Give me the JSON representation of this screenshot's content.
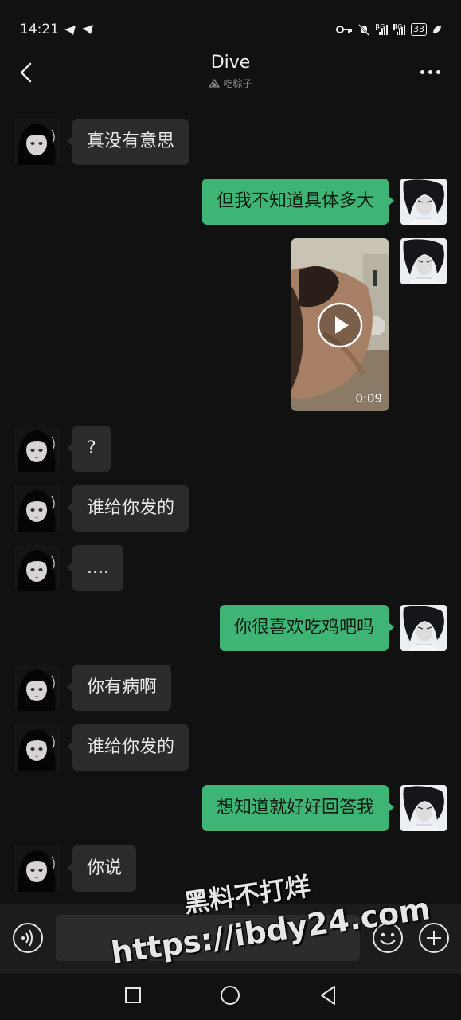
{
  "status": {
    "time": "14:21",
    "net1": "4G",
    "net2": "4G",
    "battery": "33"
  },
  "header": {
    "title": "Dive",
    "subtitle": "吃粽子",
    "back_icon": "chevron-left-icon",
    "more_icon": "more-icon"
  },
  "messages": [
    {
      "side": "in",
      "type": "text",
      "text": "真没有意思"
    },
    {
      "side": "out",
      "type": "text",
      "text": "但我不知道具体多大"
    },
    {
      "side": "out",
      "type": "video",
      "duration": "0:09"
    },
    {
      "side": "in",
      "type": "text",
      "text": "?"
    },
    {
      "side": "in",
      "type": "text",
      "text": "谁给你发的"
    },
    {
      "side": "in",
      "type": "text",
      "text": "...."
    },
    {
      "side": "out",
      "type": "text",
      "text": "你很喜欢吃鸡吧吗"
    },
    {
      "side": "in",
      "type": "text",
      "text": "你有病啊"
    },
    {
      "side": "in",
      "type": "text",
      "text": "谁给你发的"
    },
    {
      "side": "out",
      "type": "text",
      "text": "想知道就好好回答我"
    },
    {
      "side": "in",
      "type": "text",
      "text": "你说"
    }
  ],
  "input": {
    "value": "",
    "voice_icon": "voice-icon",
    "emoji_icon": "emoji-icon",
    "plus_icon": "plus-icon"
  },
  "watermark": {
    "line1": "黑料不打烊",
    "line2": "https://ibdy24.com"
  },
  "colors": {
    "background": "#111111",
    "incoming_bubble": "#2b2b2b",
    "outgoing_bubble": "#3eb575",
    "input_bar": "#1c1c1c"
  }
}
